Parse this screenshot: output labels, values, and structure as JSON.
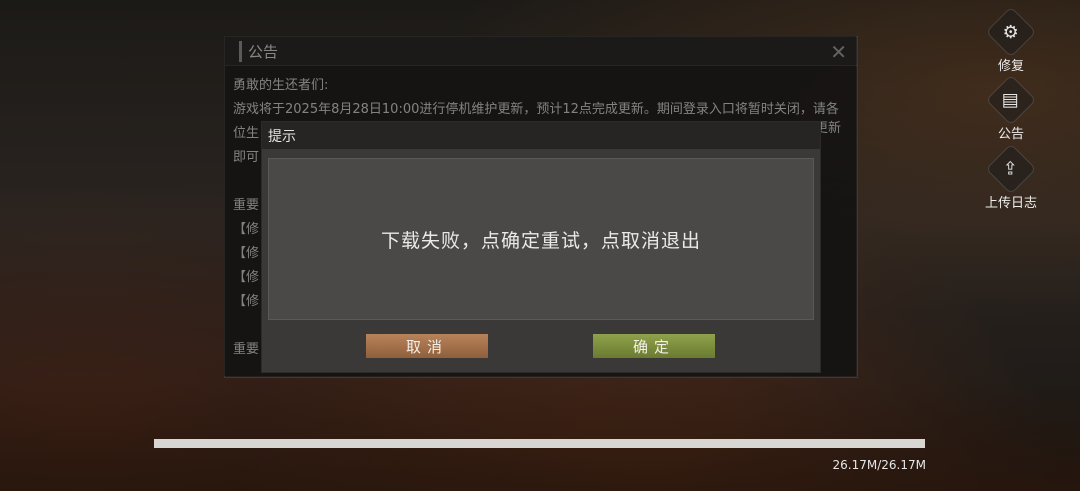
{
  "side_menu": [
    {
      "label": "修复",
      "icon": "gear-icon"
    },
    {
      "label": "公告",
      "icon": "notice-icon"
    },
    {
      "label": "上传日志",
      "icon": "upload-icon"
    }
  ],
  "announcement": {
    "title": "公告",
    "lines": [
      "勇敢的生还者们:",
      "游戏将于2025年8月28日10:00进行停机维护更新，预计12点完成更新。期间登录入口将暂时关闭，请各",
      "位生",
      "即可",
      "",
      "重要",
      "【修",
      "【修",
      "【修",
      "【修",
      "",
      "重要"
    ],
    "partial_right_1": "更新"
  },
  "dialog": {
    "title": "提示",
    "message": "下载失败，点确定重试，点取消退出",
    "cancel_label": "取消",
    "ok_label": "确定"
  },
  "progress": {
    "text": "26.17M/26.17M",
    "fraction": 1.0
  }
}
